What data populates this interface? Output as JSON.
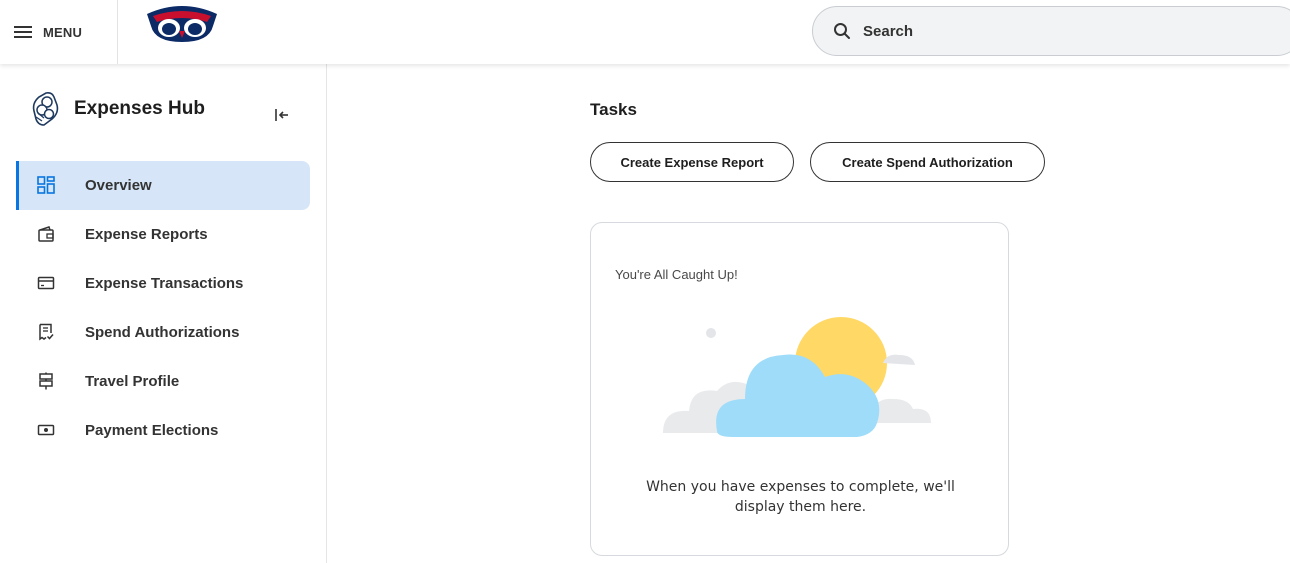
{
  "header": {
    "menu_label": "MENU",
    "search_placeholder": "Search",
    "logo_alt": "FAU owl logo"
  },
  "sidebar": {
    "hub_title": "Expenses Hub",
    "items": [
      {
        "label": "Overview",
        "icon": "overview-grid-icon",
        "active": true
      },
      {
        "label": "Expense Reports",
        "icon": "wallet-icon",
        "active": false
      },
      {
        "label": "Expense Transactions",
        "icon": "credit-card-icon",
        "active": false
      },
      {
        "label": "Spend Authorizations",
        "icon": "receipt-check-icon",
        "active": false
      },
      {
        "label": "Travel Profile",
        "icon": "signpost-icon",
        "active": false
      },
      {
        "label": "Payment Elections",
        "icon": "cash-icon",
        "active": false
      }
    ]
  },
  "main": {
    "tasks_title": "Tasks",
    "buttons": {
      "create_expense_report": "Create Expense Report",
      "create_spend_authorization": "Create Spend Authorization"
    },
    "card": {
      "heading": "You're All Caught Up!",
      "message": "When you have expenses to complete, we'll display them here."
    }
  },
  "colors": {
    "accent": "#0875e1",
    "active_bg": "#d6e6f8",
    "cloud": "#9fdcfa",
    "sun": "#ffd866"
  }
}
